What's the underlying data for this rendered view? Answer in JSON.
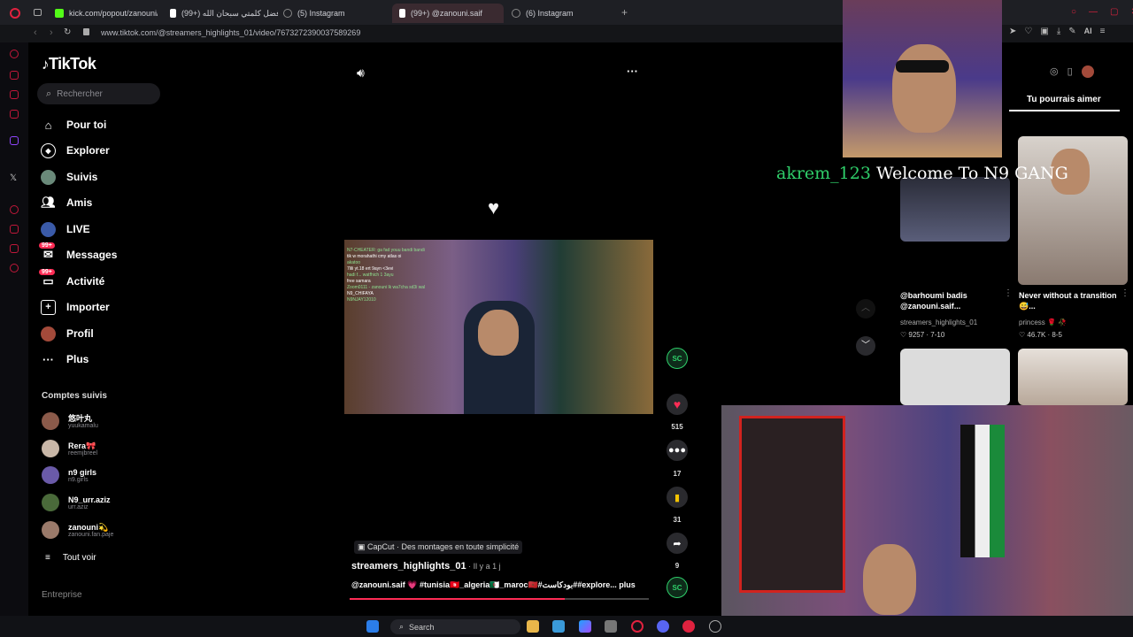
{
  "browser": {
    "tabs": [
      {
        "label": "kick.com/popout/zanouni/c",
        "color": "#53fc18",
        "active": false
      },
      {
        "label": "(99+) فضل كلمتي سبحان الله",
        "color": "#ffffff",
        "active": false
      },
      {
        "label": "(5) Instagram",
        "color": "#888888",
        "active": false
      },
      {
        "label": "(99+) @zanouni.saif",
        "color": "#ffffff",
        "active": true
      },
      {
        "label": "(6) Instagram",
        "color": "#888888",
        "active": false
      }
    ],
    "new_tab": "+",
    "url": "www.tiktok.com/@streamers_highlights_01/video/7673272390037589269",
    "ai_label": "AI"
  },
  "tiktok": {
    "logo": "TikTok",
    "search_placeholder": "Rechercher",
    "nav": [
      {
        "label": "Pour toi",
        "icon": "home-icon"
      },
      {
        "label": "Explorer",
        "icon": "compass-icon"
      },
      {
        "label": "Suivis",
        "icon": "following-avatar-icon"
      },
      {
        "label": "Amis",
        "icon": "friends-icon"
      },
      {
        "label": "LIVE",
        "icon": "live-icon"
      },
      {
        "label": "Messages",
        "icon": "messages-icon",
        "badge": "99+"
      },
      {
        "label": "Activité",
        "icon": "activity-icon",
        "badge": "99+"
      },
      {
        "label": "Importer",
        "icon": "upload-icon"
      },
      {
        "label": "Profil",
        "icon": "profile-icon"
      },
      {
        "label": "Plus",
        "icon": "more-icon"
      }
    ],
    "following_title": "Comptes suivis",
    "accounts": [
      {
        "name": "悠叶丸",
        "user": "yuukamalu",
        "color": "#8b5a4a"
      },
      {
        "name": "Rera🎀",
        "user": "reemjbreel",
        "color": "#c9b7a8"
      },
      {
        "name": "n9 girls",
        "user": "n9.girls",
        "color": "#6a5aa8"
      },
      {
        "name": "N9_urr.aziz",
        "user": "urr.aziz",
        "color": "#4a6a3a"
      },
      {
        "name": "zanouni💫",
        "user": "zanouni.fan.paje",
        "color": "#9a7a6a"
      }
    ],
    "see_all": "Tout voir",
    "footer": "Entreprise",
    "video": {
      "likes": "515",
      "comments": "17",
      "saves": "31",
      "shares": "9",
      "capcut": "CapCut · Des montages en toute simplicité",
      "author": "streamers_highlights_01",
      "time": " · Il y a 1 j",
      "caption": "@zanouni.saif 💗 #tunisia🇹🇳_algeria🇩🇿_maroc🇲🇦#بودكاست##explore...",
      "more": "plus",
      "chat_lines": [
        "N7-CHEATER: ga fad youu bandi bandi",
        "tik w morahathi cmy atlas oi",
        "akatoo",
        "7lili yt.18 ert 9ayn <3evi",
        "hadi f... watfhich 1 3ayu",
        "free samara",
        "Zoom0111 - zanouni lk wa7cha sd3i wal",
        "N9_CHIFAYA",
        "N9NJAY12010"
      ]
    },
    "suggest_title": "Tu pourrais aimer",
    "cards": [
      {
        "title": "@barhoumi badis @zanouni.saif...",
        "user": "streamers_highlights_01",
        "meta": "♡ 9257 · 7-10"
      },
      {
        "title": "Never without a transition 😅...",
        "user": "princess 🌹 🥀",
        "meta": "♡ 46.7K · 8-5"
      }
    ]
  },
  "overlay": {
    "user": "akrem_123",
    "text": "Welcome To N9 GANG",
    "user_color": "#2fcf6a"
  },
  "taskbar": {
    "search": "Search"
  }
}
